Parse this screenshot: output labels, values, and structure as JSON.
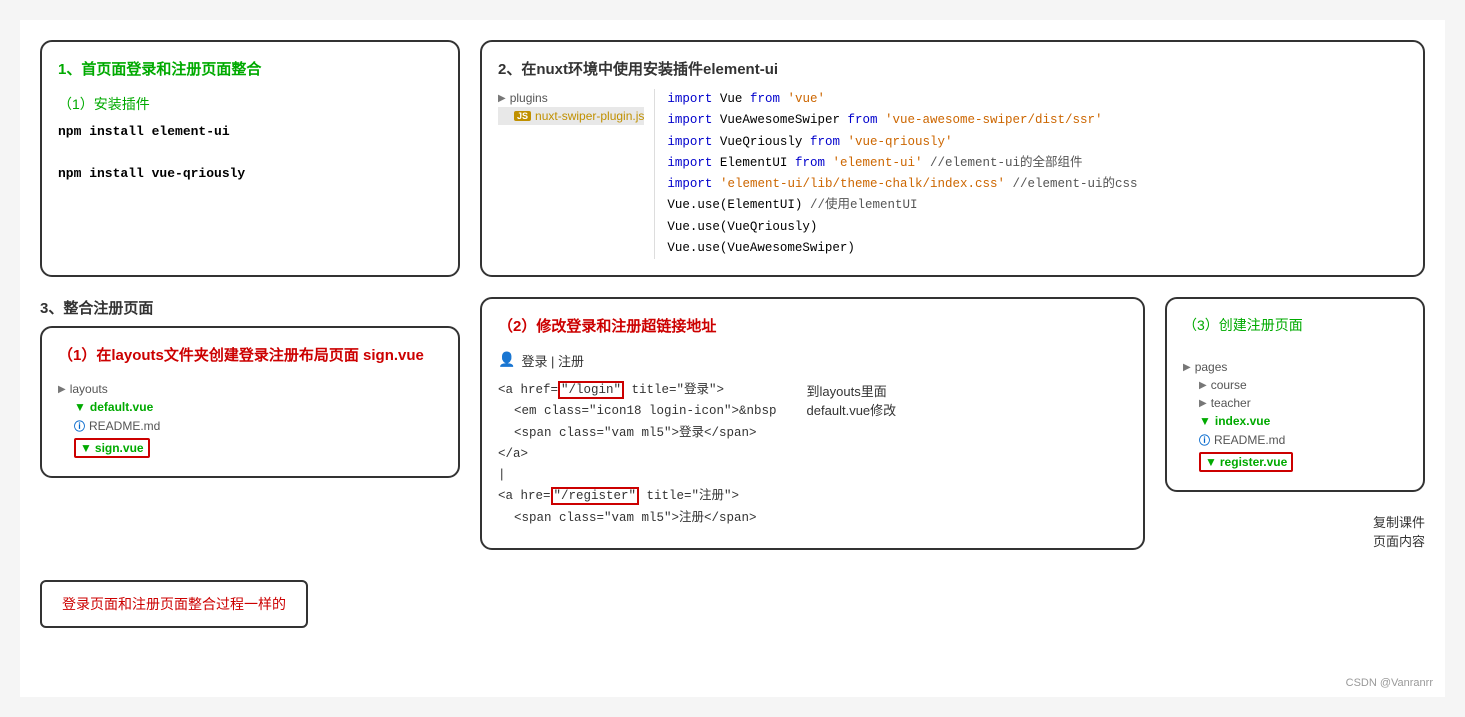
{
  "page": {
    "background": "#f5f5f5",
    "footer_credit": "CSDN @Vanranrr"
  },
  "box1": {
    "section_number": "1、首页面登录和注册页面整合",
    "sub_title": "（1）安装插件",
    "code_lines": [
      "npm install element-ui",
      "",
      "npm install vue-qriously"
    ]
  },
  "box2": {
    "section_number": "2、在nuxt环境中使用安装插件element-ui",
    "file_tree": {
      "root": "plugins",
      "file": "nuxt-swiper-plugin.js"
    },
    "code_lines": [
      "import Vue from 'vue'",
      "import VueAwesomeSwiper from 'vue-awesome-swiper/dist/ssr'",
      "import VueQriously from 'vue-qriously'",
      "import ElementUI from 'element-ui' //element-ui的全部组件",
      "import 'element-ui/lib/theme-chalk/index.css' //element-ui的css",
      "Vue.use(ElementUI) //使用elementUI",
      "Vue.use(VueQriously)",
      "Vue.use(VueAwesomeSwiper)"
    ]
  },
  "box3": {
    "section_number": "3、整合注册页面",
    "sub_title": "（1）在layouts文件夹创建登录注册布局页面 sign.vue",
    "file_tree": {
      "root": "layouts",
      "files": [
        "default.vue",
        "README.md",
        "sign.vue"
      ]
    }
  },
  "box4": {
    "sub_title": "（2）修改登录和注册超链接地址",
    "side_note_line1": "到layouts里面",
    "side_note_line2": "default.vue修改",
    "nav_text": "登录 | 注册",
    "code_lines": [
      "<a href=\"\"/login\"\" title=\"登录\">",
      "    <em class=\"icon18 login-icon\">&nbsp",
      "    <span class=\"vam ml5\">登录</span>",
      "</a>",
      "|",
      "<a hre=\"\"/register\"\" title=\"注册\">",
      "    <span class=\"vam ml5\">注册</span>"
    ]
  },
  "box5": {
    "sub_title": "（3）创建注册页面",
    "file_tree": {
      "root": "pages",
      "folders": [
        "course",
        "teacher"
      ],
      "files": [
        "index.vue",
        "README.md",
        "register.vue"
      ]
    },
    "copy_note_line1": "复制课件",
    "copy_note_line2": "页面内容"
  },
  "bottom_note": {
    "text": "登录页面和注册页面整合过程一样的"
  }
}
